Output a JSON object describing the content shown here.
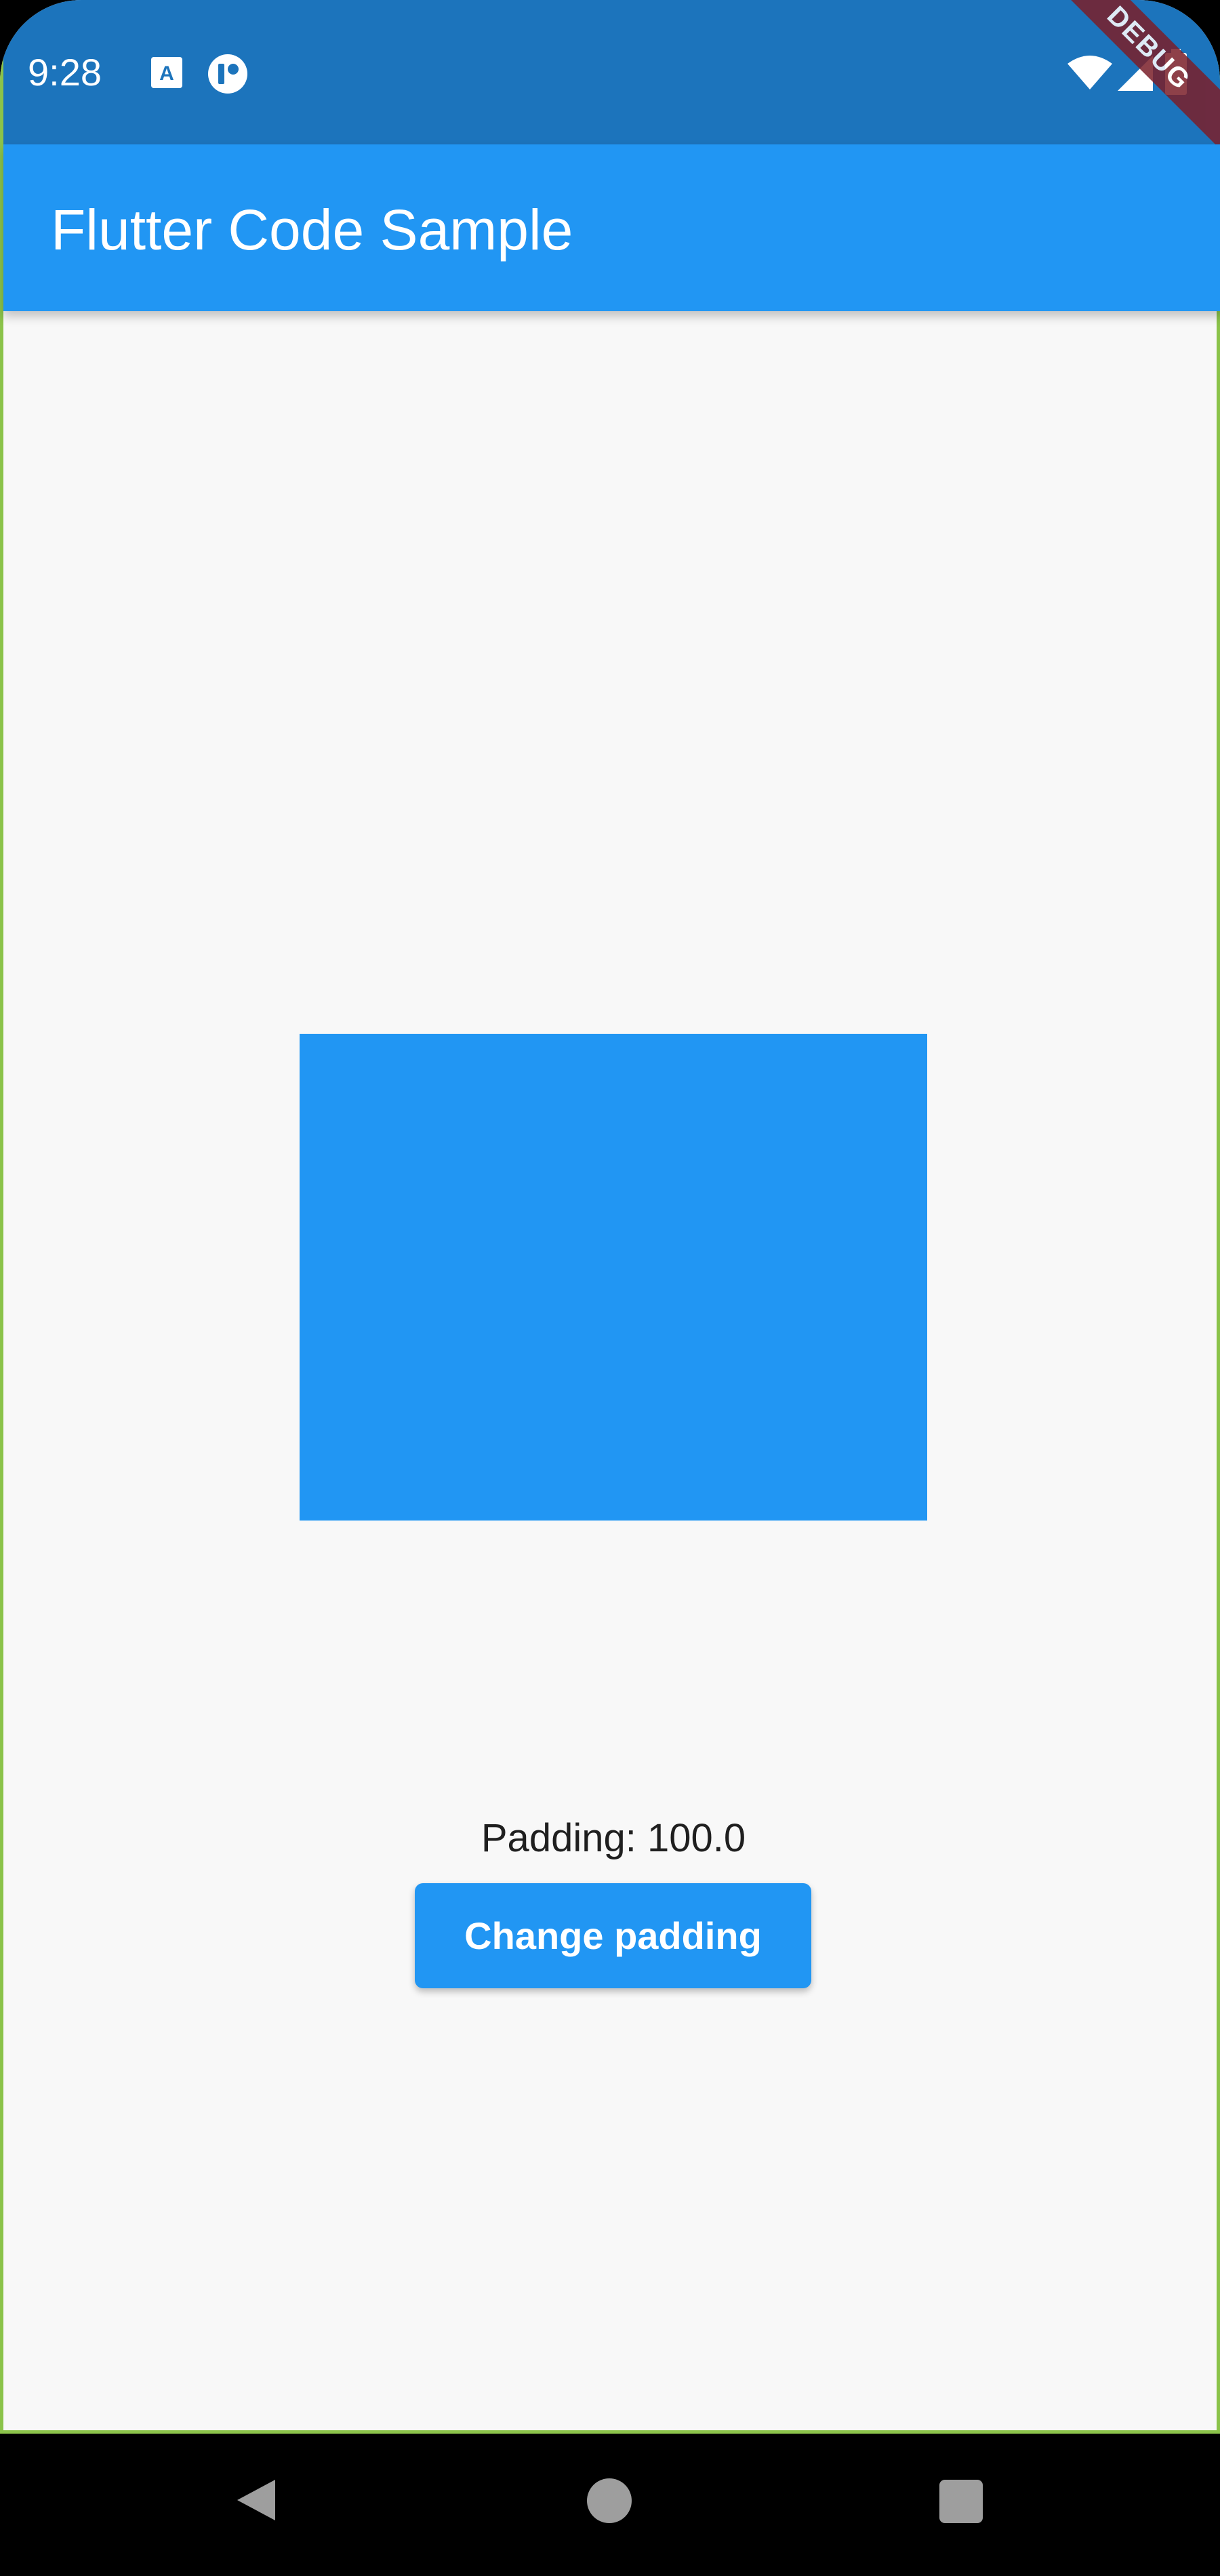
{
  "status_bar": {
    "time": "9:28",
    "icons_left": [
      "a-notification-icon",
      "notification-app-icon"
    ],
    "icons_right": [
      "wifi-icon",
      "cell-signal-icon",
      "battery-icon"
    ],
    "debug_banner": "DEBUG"
  },
  "app_bar": {
    "title": "Flutter Code Sample"
  },
  "content": {
    "padding_label": "Padding: 100.0",
    "button_label": "Change padding"
  },
  "nav_bar": {
    "icons": [
      "back-icon",
      "home-icon",
      "recents-icon"
    ]
  },
  "colors": {
    "status_bar": "#1c74bc",
    "app_bar": "#2196f3",
    "box": "#2196f3",
    "background": "#f8f8f8",
    "nav_bar": "#000000"
  }
}
